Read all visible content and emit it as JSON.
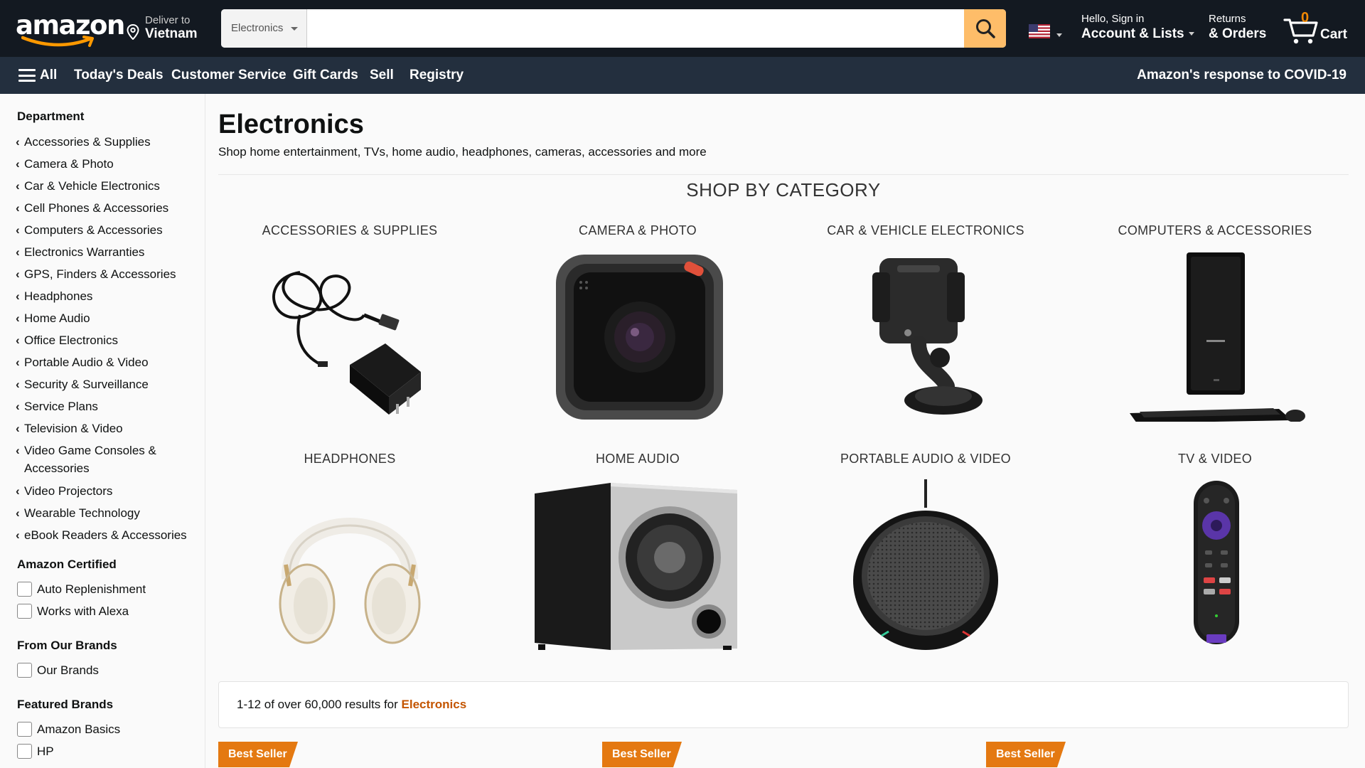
{
  "header": {
    "logo": "amazon",
    "deliver_line1": "Deliver to",
    "deliver_line2": "Vietnam",
    "search_category": "Electronics",
    "search_placeholder": "",
    "account_line1": "Hello, Sign in",
    "account_line2": "Account & Lists",
    "returns_line1": "Returns",
    "returns_line2": "& Orders",
    "cart_count": "0",
    "cart_label": "Cart",
    "accent_color": "#febd69",
    "bg_color": "#131921"
  },
  "subnav": {
    "all_label": "All",
    "items": [
      "Today's Deals",
      "Customer Service",
      "Gift Cards",
      "Sell",
      "Registry"
    ],
    "covid_link": "Amazon's response to COVID-19",
    "bg_color": "#232f3e"
  },
  "sidebar": {
    "department_heading": "Department",
    "departments": [
      "Accessories & Supplies",
      "Camera & Photo",
      "Car & Vehicle Electronics",
      "Cell Phones & Accessories",
      "Computers & Accessories",
      "Electronics Warranties",
      "GPS, Finders & Accessories",
      "Headphones",
      "Home Audio",
      "Office Electronics",
      "Portable Audio & Video",
      "Security & Surveillance",
      "Service Plans",
      "Television & Video",
      "Video Game Consoles &",
      "Accessories",
      "Video Projectors",
      "Wearable Technology",
      "eBook Readers & Accessories"
    ],
    "amazon_certified_heading": "Amazon Certified",
    "amazon_certified": [
      "Auto Replenishment",
      "Works with Alexa"
    ],
    "our_brands_heading": "From Our Brands",
    "our_brands": [
      "Our Brands"
    ],
    "featured_brands_heading": "Featured Brands",
    "featured_brands": [
      "Amazon Basics",
      "HP"
    ]
  },
  "main": {
    "title": "Electronics",
    "subtitle": "Shop home entertainment, TVs, home audio, headphones, cameras, accessories and more",
    "shop_by_category": "SHOP BY CATEGORY",
    "categories": [
      {
        "label": "ACCESSORIES & SUPPLIES",
        "icon": "usb-cable-charger-icon"
      },
      {
        "label": "CAMERA & PHOTO",
        "icon": "action-camera-icon"
      },
      {
        "label": "CAR & VEHICLE ELECTRONICS",
        "icon": "phone-car-mount-icon"
      },
      {
        "label": "COMPUTERS & ACCESSORIES",
        "icon": "desktop-tower-icon"
      },
      {
        "label": "HEADPHONES",
        "icon": "headphones-icon"
      },
      {
        "label": "HOME AUDIO",
        "icon": "subwoofer-icon"
      },
      {
        "label": "PORTABLE AUDIO & VIDEO",
        "icon": "speakerphone-icon"
      },
      {
        "label": "TV & VIDEO",
        "icon": "remote-control-icon"
      }
    ],
    "results_prefix": "1-12 of over 60,000 results for ",
    "results_query": "Electronics",
    "badges": [
      "Best Seller",
      "Best Seller",
      "Best Seller"
    ],
    "badge_color": "#e47911"
  }
}
